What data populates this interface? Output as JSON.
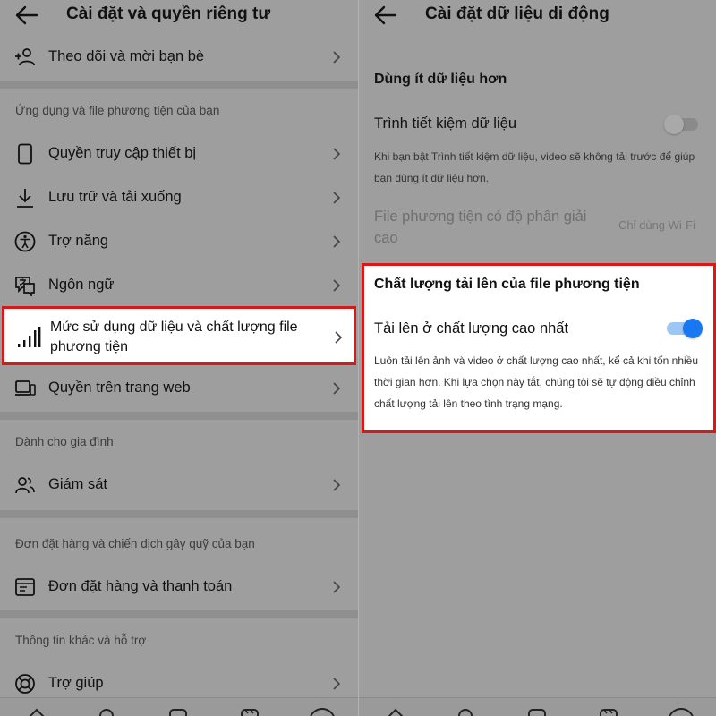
{
  "left": {
    "title": "Cài đặt và quyền riêng tư",
    "top_item": {
      "label": "Theo dõi và mời bạn bè",
      "icon": "add-person-icon"
    },
    "section_apps": {
      "header": "Ứng dụng và file phương tiện của bạn",
      "items": [
        {
          "label": "Quyền truy cập thiết bị",
          "icon": "phone-icon"
        },
        {
          "label": "Lưu trữ và tải xuống",
          "icon": "download-icon"
        },
        {
          "label": "Trợ năng",
          "icon": "accessibility-icon"
        },
        {
          "label": "Ngôn ngữ",
          "icon": "language-icon"
        },
        {
          "label": "Mức sử dụng dữ liệu và chất lượng file phương tiện",
          "icon": "signal-bars-icon"
        },
        {
          "label": "Quyền trên trang web",
          "icon": "monitor-icon"
        }
      ]
    },
    "section_family": {
      "header": "Dành cho gia đình",
      "items": [
        {
          "label": "Giám sát",
          "icon": "people-icon"
        }
      ]
    },
    "section_orders": {
      "header": "Đơn đặt hàng và chiến dịch gây quỹ của bạn",
      "items": [
        {
          "label": "Đơn đặt hàng và thanh toán",
          "icon": "receipt-icon"
        }
      ]
    },
    "section_support": {
      "header": "Thông tin khác và hỗ trợ",
      "items": [
        {
          "label": "Trợ giúp",
          "icon": "lifebuoy-icon"
        }
      ]
    }
  },
  "right": {
    "title": "Cài đặt dữ liệu di động",
    "less_data_header": "Dùng ít dữ liệu hơn",
    "data_saver": {
      "label": "Trình tiết kiệm dữ liệu",
      "enabled": false,
      "description": "Khi bạn bật Trình tiết kiệm dữ liệu, video sẽ không tải trước để giúp bạn dùng ít dữ liệu hơn."
    },
    "hd_media": {
      "label": "File phương tiện có độ phân giải cao",
      "value": "Chỉ dùng Wi-Fi"
    },
    "upload_quality": {
      "header": "Chất lượng tải lên của file phương tiện",
      "label": "Tải lên ở chất lượng cao nhất",
      "enabled": true,
      "description": "Luôn tải lên ảnh và video ở chất lượng cao nhất, kể cả khi tốn nhiều thời gian hơn. Khi lựa chọn này tắt, chúng tôi sẽ tự động điều chỉnh chất lượng tải lên theo tình trạng mạng."
    }
  },
  "colors": {
    "dim_background": "#9e9e9e",
    "highlight_border": "#d51a1a",
    "toggle_on": "#1877f2",
    "toggle_on_track": "#9cc6f5"
  }
}
